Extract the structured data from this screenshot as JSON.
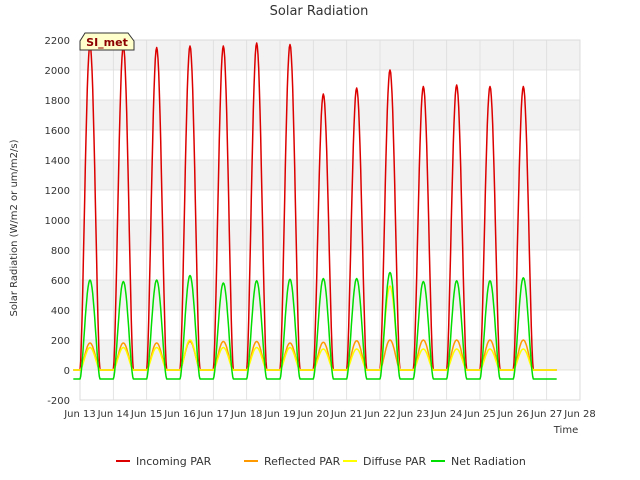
{
  "chart_data": {
    "type": "line",
    "title": "Solar Radiation",
    "xlabel": "Time",
    "ylabel": "Solar Radiation (W/m2 or um/m2/s)",
    "site_label": "SI_met",
    "x_ticks": [
      "Jun 13",
      "Jun 14",
      "Jun 15",
      "Jun 16",
      "Jun 17",
      "Jun 18",
      "Jun 19",
      "Jun 20",
      "Jun 21",
      "Jun 22",
      "Jun 23",
      "Jun 24",
      "Jun 25",
      "Jun 26",
      "Jun 27",
      "Jun 28"
    ],
    "xlim": [
      13,
      28
    ],
    "ylim": [
      -200,
      2200
    ],
    "y_ticks": [
      -200,
      0,
      200,
      400,
      600,
      800,
      1000,
      1200,
      1400,
      1600,
      1800,
      2000,
      2200
    ],
    "grid": true,
    "legend_position": "bottom",
    "days": [
      13.3,
      14.3,
      15.3,
      16.3,
      17.3,
      18.3,
      19.3,
      20.3,
      21.3,
      22.3,
      23.3,
      24.3,
      25.3,
      26.3
    ],
    "day_span": [
      13.3,
      27.3
    ],
    "series": [
      {
        "name": "Incoming PAR",
        "color": "#dd0000",
        "night": 0,
        "daily_peak": [
          2170,
          2160,
          2150,
          2160,
          2160,
          2180,
          2170,
          1840,
          1880,
          2000,
          1890,
          1900,
          1890,
          1890
        ]
      },
      {
        "name": "Reflected PAR",
        "color": "#ff9900",
        "night": 0,
        "daily_peak": [
          180,
          180,
          180,
          190,
          190,
          190,
          180,
          185,
          195,
          200,
          200,
          200,
          200,
          200
        ]
      },
      {
        "name": "Diffuse PAR",
        "color": "#ffff00",
        "night": 0,
        "daily_peak": [
          150,
          150,
          150,
          200,
          150,
          150,
          150,
          140,
          140,
          560,
          140,
          140,
          140,
          140
        ]
      },
      {
        "name": "Net Radiation",
        "color": "#00dd00",
        "night": -60,
        "daily_peak": [
          600,
          590,
          600,
          630,
          580,
          595,
          605,
          610,
          610,
          650,
          590,
          595,
          595,
          615
        ]
      }
    ]
  }
}
